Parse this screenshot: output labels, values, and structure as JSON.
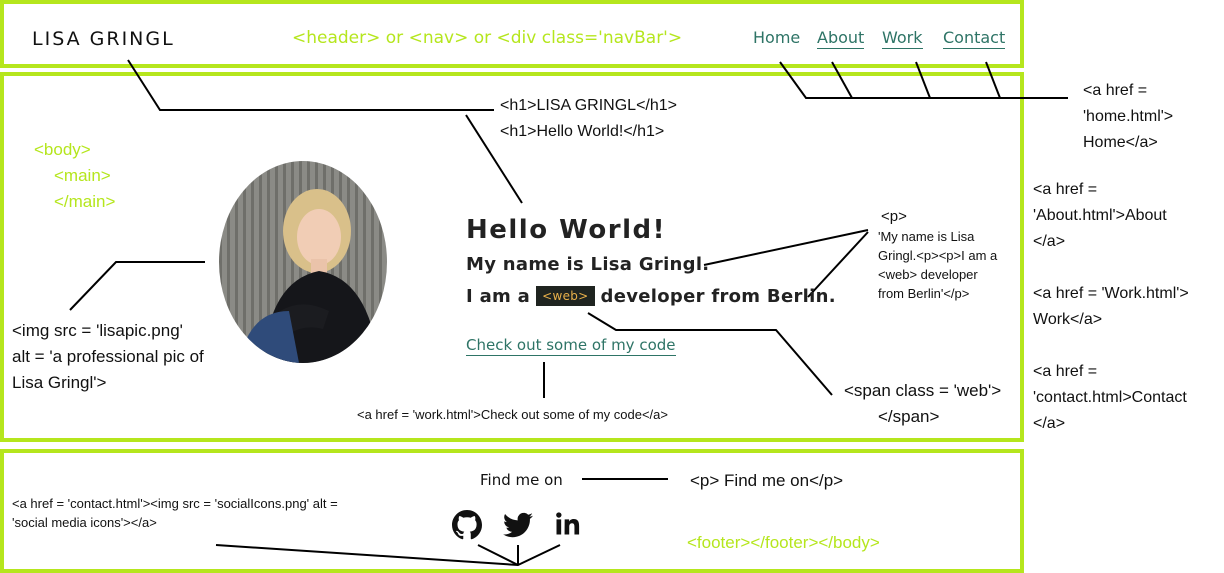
{
  "header": {
    "logo": "LISA GRINGL",
    "annotation": "<header> or <nav> or <div class='navBar'>",
    "nav": [
      {
        "label": "Home"
      },
      {
        "label": "About"
      },
      {
        "label": "Work"
      },
      {
        "label": "Contact"
      }
    ]
  },
  "body_annotation": {
    "line1": "<body>",
    "line2": "<main>",
    "line3": "</main>"
  },
  "h1_annotation": {
    "line1": "<h1>LISA GRINGL</h1>",
    "line2": "<h1>Hello World!</h1>"
  },
  "main": {
    "hello": "Hello World!",
    "intro_line1": "My name is Lisa Gringl.",
    "intro_line2_a": "I am a",
    "web_tag": "<web>",
    "intro_line2_b": "developer from Berlin.",
    "code_link": "Check out some of my code"
  },
  "p_annotation": {
    "tag": "<p>",
    "line1": "'My name is Lisa",
    "line2": "Gringl.<p><p>I am a",
    "line3": "<web> developer",
    "line4": "from Berlin'</p>"
  },
  "img_annotation": {
    "line1": "<img src = 'lisapic.png'",
    "line2": "alt = 'a professional pic of",
    "line3": "Lisa Gringl'>"
  },
  "span_annotation": {
    "line1": "<span class = 'web'>",
    "line2": "</span>"
  },
  "code_link_annotation": "<a href = 'work.html'>Check out some of my code</a>",
  "nav_annotations": {
    "home": [
      "<a href =",
      "'home.html'>",
      "Home</a>"
    ],
    "about": [
      "<a href =",
      "'About.html'>About",
      "</a>"
    ],
    "work": [
      "<a href = 'Work.html'>",
      "Work</a>"
    ],
    "contact": [
      "<a href =",
      "'contact.html>Contact",
      "</a>"
    ]
  },
  "footer": {
    "find_me": "Find me on",
    "p_annotation": "<p>  Find me on</p>",
    "social_annotation_1": "<a href = 'contact.html'><img src = 'socialIcons.png' alt =",
    "social_annotation_2": "'social media icons'></a>",
    "footer_annotation": "<footer></footer></body>",
    "icons": [
      "github-icon",
      "twitter-icon",
      "linkedin-icon"
    ]
  },
  "colors": {
    "border_green": "#b5e61d",
    "link_teal": "#2e7466",
    "web_tag_bg": "#1f2420",
    "web_tag_text": "#e8b04a"
  }
}
